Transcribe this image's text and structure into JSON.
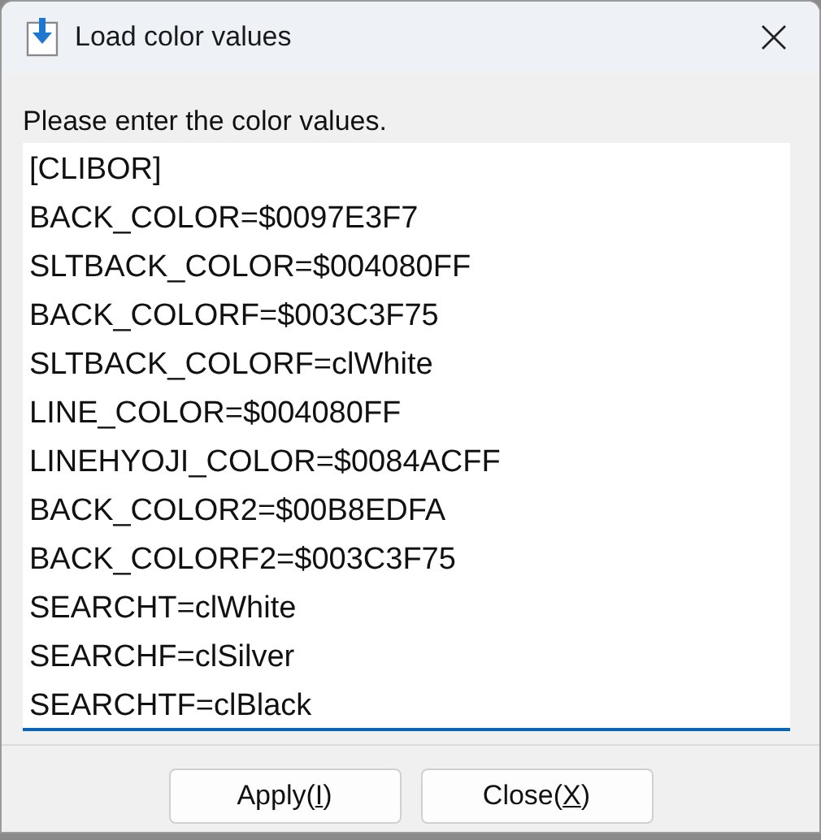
{
  "window": {
    "title": "Load color values"
  },
  "prompt": "Please enter the color values.",
  "memo": {
    "lines": [
      "[CLIBOR]",
      "BACK_COLOR=$0097E3F7",
      "SLTBACK_COLOR=$004080FF",
      "BACK_COLORF=$003C3F75",
      "SLTBACK_COLORF=clWhite",
      "LINE_COLOR=$004080FF",
      "LINEHYOJI_COLOR=$0084ACFF",
      "BACK_COLOR2=$00B8EDFA",
      "BACK_COLORF2=$003C3F75",
      "SEARCHT=clWhite",
      "SEARCHF=clSilver",
      "SEARCHTF=clBlack"
    ]
  },
  "buttons": [
    {
      "before": "Apply(",
      "hotkey": "I",
      "after": ")"
    },
    {
      "before": "Close(",
      "hotkey": "X",
      "after": ")"
    }
  ]
}
